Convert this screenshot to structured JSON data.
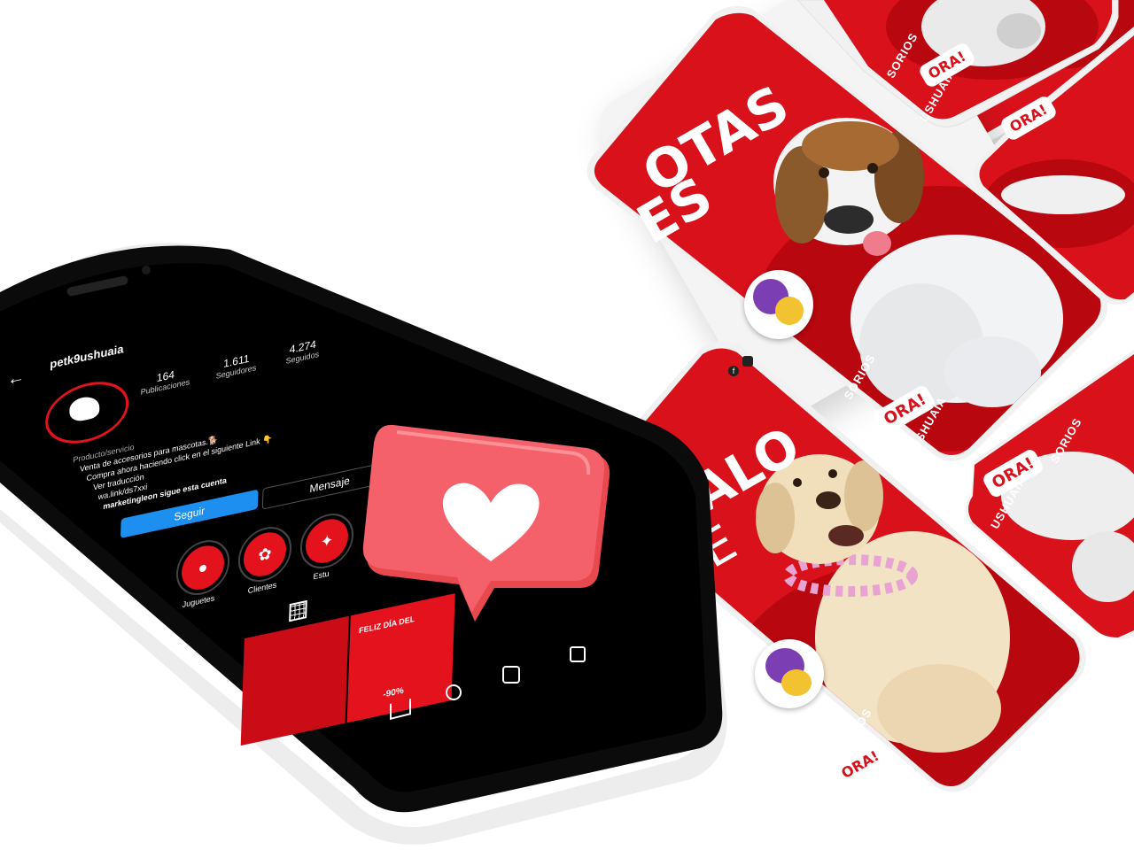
{
  "instagram": {
    "username": "petk9ushuaia",
    "back_icon": "back-arrow-icon",
    "stats": [
      {
        "value": "164",
        "label": "Publicaciones"
      },
      {
        "value": "1.611",
        "label": "Seguidores"
      },
      {
        "value": "4.274",
        "label": "Seguidos"
      }
    ],
    "category": "Producto/servicio",
    "bio_lines": [
      "Venta de accesorios para mascotas.🐕",
      "Compra ahora haciendo click en el siguiente Link 👇",
      "Ver traducción",
      "wa.link/ds7xxi",
      "marketingleon sigue esta cuenta"
    ],
    "follow_label": "Seguir",
    "message_label": "Mensaje",
    "highlights": [
      "Juguetes",
      "Clientes",
      "Estu"
    ],
    "grid_caption_1": "FELIZ DÍA DEL",
    "grid_caption_2": "-90%",
    "bottom_nav": [
      "home-icon",
      "search-icon",
      "reels-icon"
    ]
  },
  "mockups": {
    "text_a": "OTAS",
    "text_a2": "ES",
    "text_b": "AJALO",
    "text_b2": "SE",
    "text_b3": "E",
    "vertical_1": "SORIOS",
    "vertical_2": "USHUAIA",
    "cta": "ORA!"
  },
  "colors": {
    "brand_red": "#d8111b",
    "dark_red": "#b8070f",
    "ig_blue": "#1d8ff0",
    "heart_bg": "#f0555e"
  }
}
